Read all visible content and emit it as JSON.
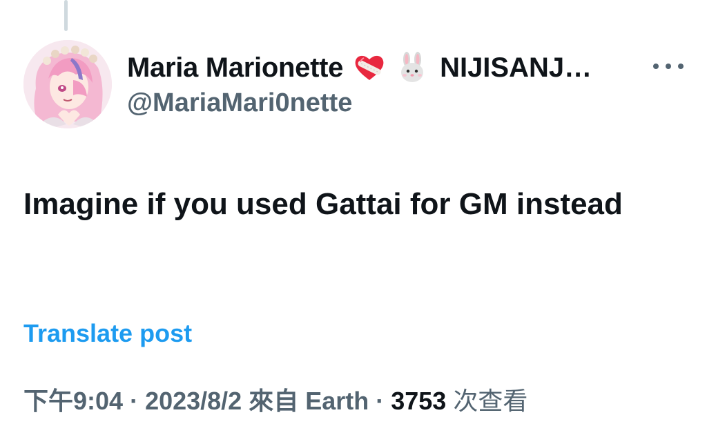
{
  "author": {
    "display_name": "Maria Marionette",
    "name_suffix": "NIJISANJ…",
    "handle": "@MariaMari0nette",
    "avatar": "avatar-image",
    "badges": [
      "mending-heart-icon",
      "rabbit-face-icon"
    ]
  },
  "post": {
    "text": "Imagine if you used Gattai for GM instead",
    "translate_label": "Translate post"
  },
  "meta": {
    "time": "下午9:04",
    "separator": "·",
    "date": "2023/8/2",
    "location": "來自 Earth",
    "views_count": "3753",
    "views_label": "次查看"
  },
  "colors": {
    "text_primary": "#0f1419",
    "text_secondary": "#536471",
    "link": "#1d9bf0",
    "thread_line": "#cfd9de",
    "background": "#ffffff"
  },
  "icons": {
    "more": "more-horizontal-icon"
  }
}
